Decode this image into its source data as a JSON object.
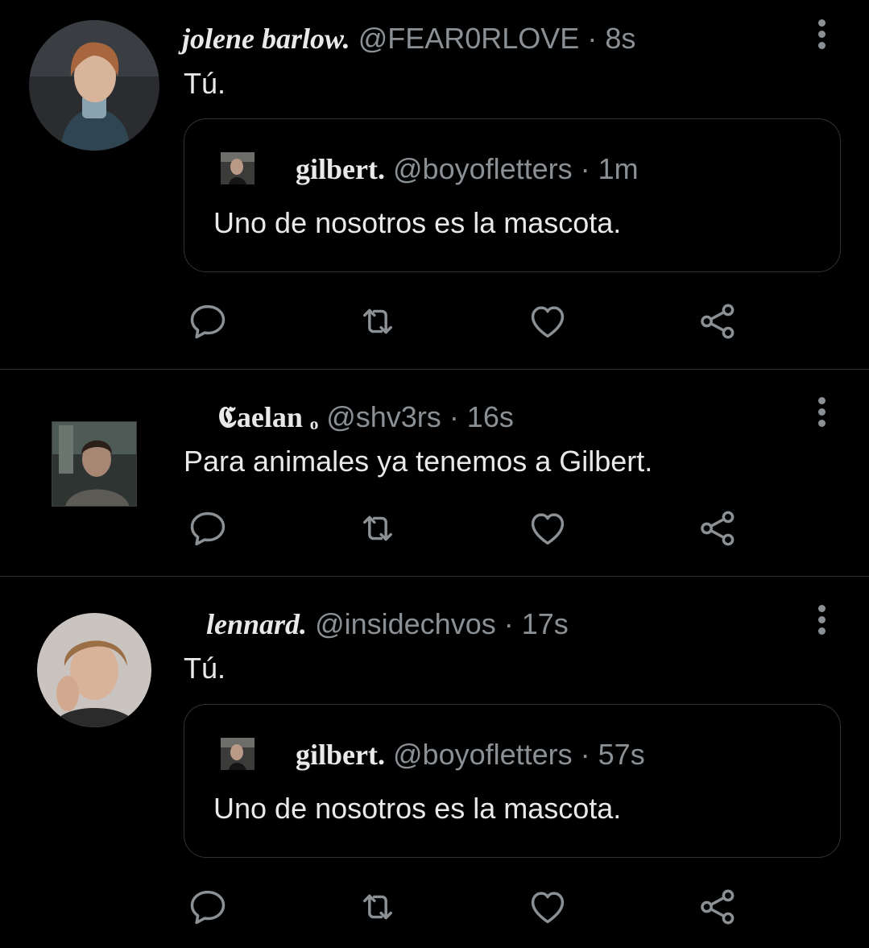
{
  "tweets": [
    {
      "name": "jolene barlow.",
      "handle": "@FEAR0RLOVE",
      "time": "· 8s",
      "text": "Tú.",
      "quote": {
        "name": "gilbert.",
        "handle": "@boyofletters",
        "time": "· 1m",
        "text": "Uno de nosotros es la mascota."
      }
    },
    {
      "name": "𝕮aelan ₒ",
      "handle": "@shv3rs",
      "time": "· 16s",
      "text": "Para animales ya tenemos a Gilbert."
    },
    {
      "name": "lennard.",
      "handle": "@insidechvos",
      "time": "· 17s",
      "text": "Tú.",
      "quote": {
        "name": "gilbert.",
        "handle": "@boyofletters",
        "time": "· 57s",
        "text": "Uno de nosotros es la mascota."
      }
    }
  ],
  "icons": [
    "reply-icon",
    "retweet-icon",
    "like-icon",
    "share-icon",
    "more-icon"
  ],
  "colors": {
    "background": "#000000",
    "text": "#e7e9ea",
    "muted": "#8b9095",
    "border": "#2f3336"
  }
}
